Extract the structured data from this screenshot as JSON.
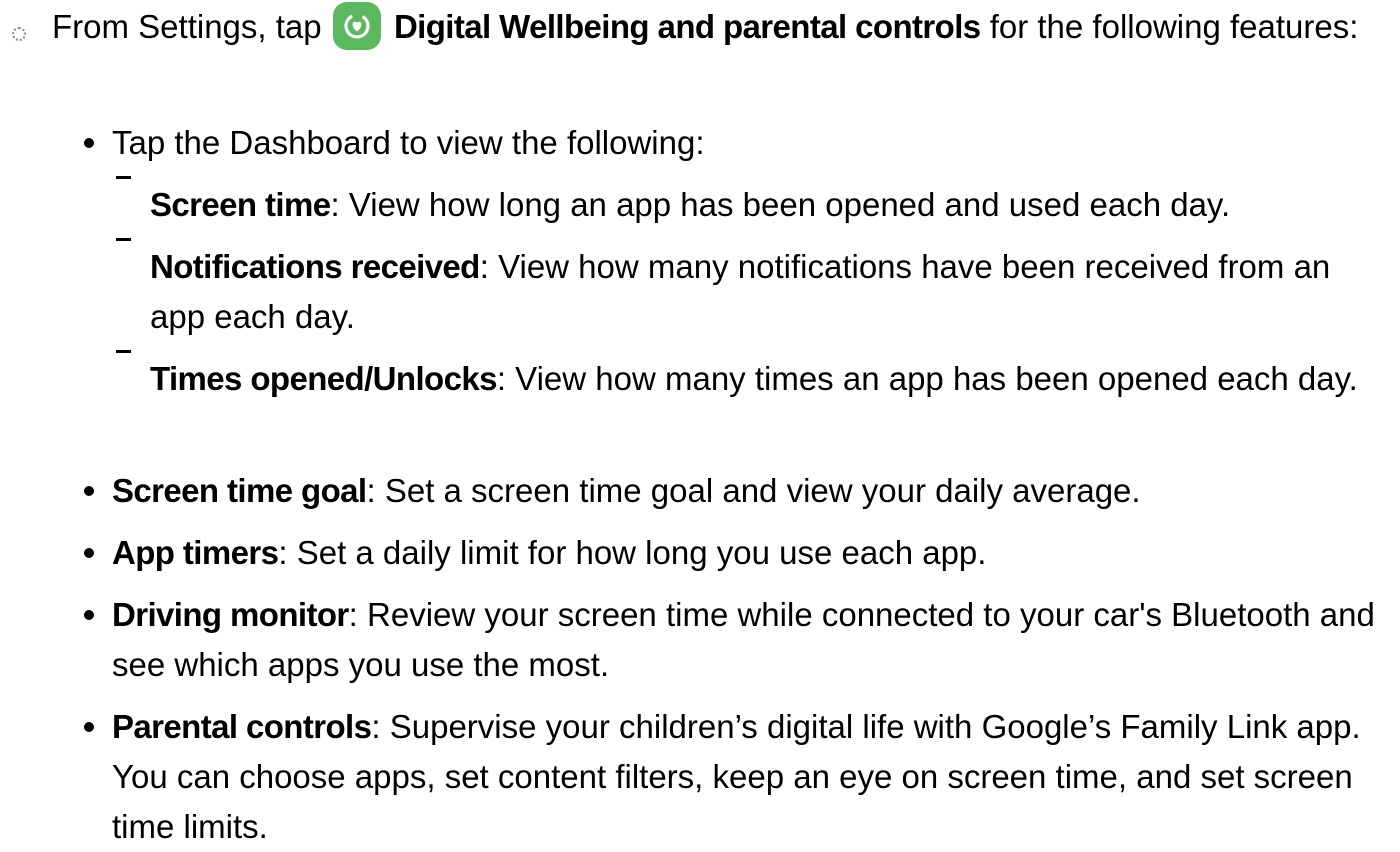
{
  "step": {
    "intro": "From Settings, tap",
    "app_name": "Digital Wellbeing and parental controls",
    "after": "for the following features:",
    "icon": "digital-wellbeing-icon",
    "icon_color": "#5cb85f"
  },
  "dashboard": {
    "text": "Tap the Dashboard to view the following:",
    "items": [
      {
        "term": "Screen time",
        "desc": ": View how long an app has been opened and used each day."
      },
      {
        "term": "Notifications received",
        "desc": ": View how many notifications have been received from an app each day."
      },
      {
        "term": "Times opened/Unlocks",
        "desc": ": View how many times an app has been opened each day."
      }
    ]
  },
  "features": [
    {
      "term": "Screen time goal",
      "desc": ": Set a screen time goal and view your daily average."
    },
    {
      "term": "App timers",
      "desc": ": Set a daily limit for how long you use each app."
    },
    {
      "term": "Driving monitor",
      "desc": ": Review your screen time while connected to your car's Bluetooth and see which apps you use the most."
    },
    {
      "term": "Parental controls",
      "desc": ": Supervise your children’s digital life with Google’s Family Link app. You can choose apps, set content filters, keep an eye on screen time, and set screen time limits."
    }
  ]
}
